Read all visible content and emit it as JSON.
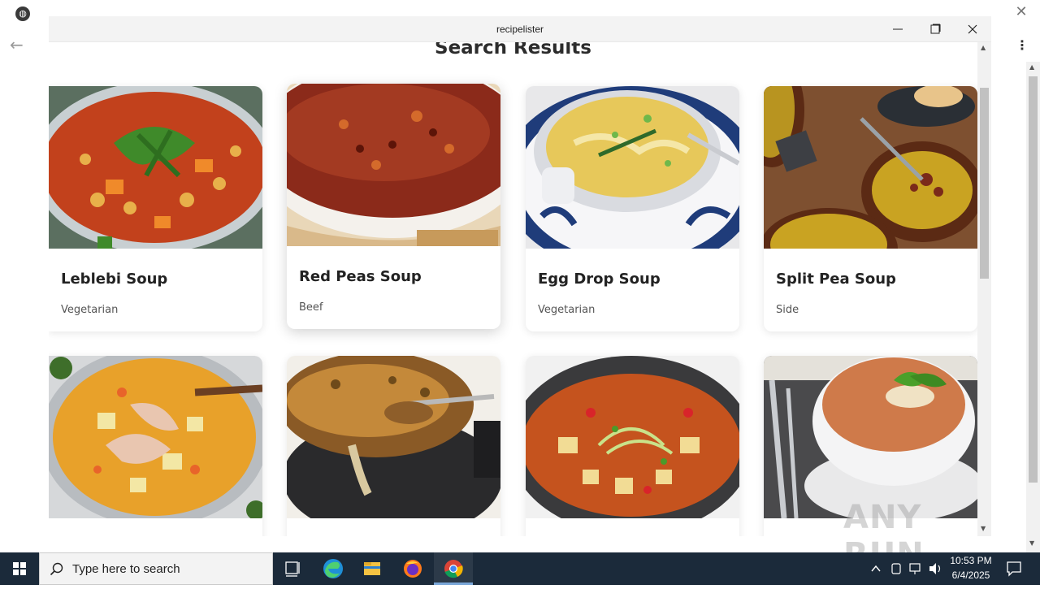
{
  "window": {
    "title": "recipelister",
    "minimize_glyph": "—",
    "maximize_glyph": "☐",
    "close_glyph": "✕"
  },
  "page": {
    "heading": "Search Results"
  },
  "recipes": [
    {
      "title": "Leblebi Soup",
      "category": "Vegetarian",
      "image": "tomato-chickpea-soup"
    },
    {
      "title": "Red Peas Soup",
      "category": "Beef",
      "image": "red-bean-soup"
    },
    {
      "title": "Egg Drop Soup",
      "category": "Vegetarian",
      "image": "egg-drop-soup"
    },
    {
      "title": "Split Pea Soup",
      "category": "Side",
      "image": "split-pea-soup"
    },
    {
      "title": "",
      "category": "",
      "image": "chicken-potato-soup"
    },
    {
      "title": "",
      "category": "",
      "image": "french-onion-soup"
    },
    {
      "title": "",
      "category": "",
      "image": "vegetable-soup"
    },
    {
      "title": "",
      "category": "",
      "image": "tomato-bisque"
    }
  ],
  "taskbar": {
    "search_placeholder": "Type here to search",
    "time": "10:53 PM",
    "date": "6/4/2025",
    "apps": [
      "task-view",
      "edge",
      "file-explorer",
      "firefox",
      "chrome"
    ]
  },
  "watermark": "ANY RUN",
  "colors": {
    "taskbar_bg": "#1b2a3a",
    "titlebar_bg": "#f3f3f3",
    "card_title": "#222222"
  }
}
